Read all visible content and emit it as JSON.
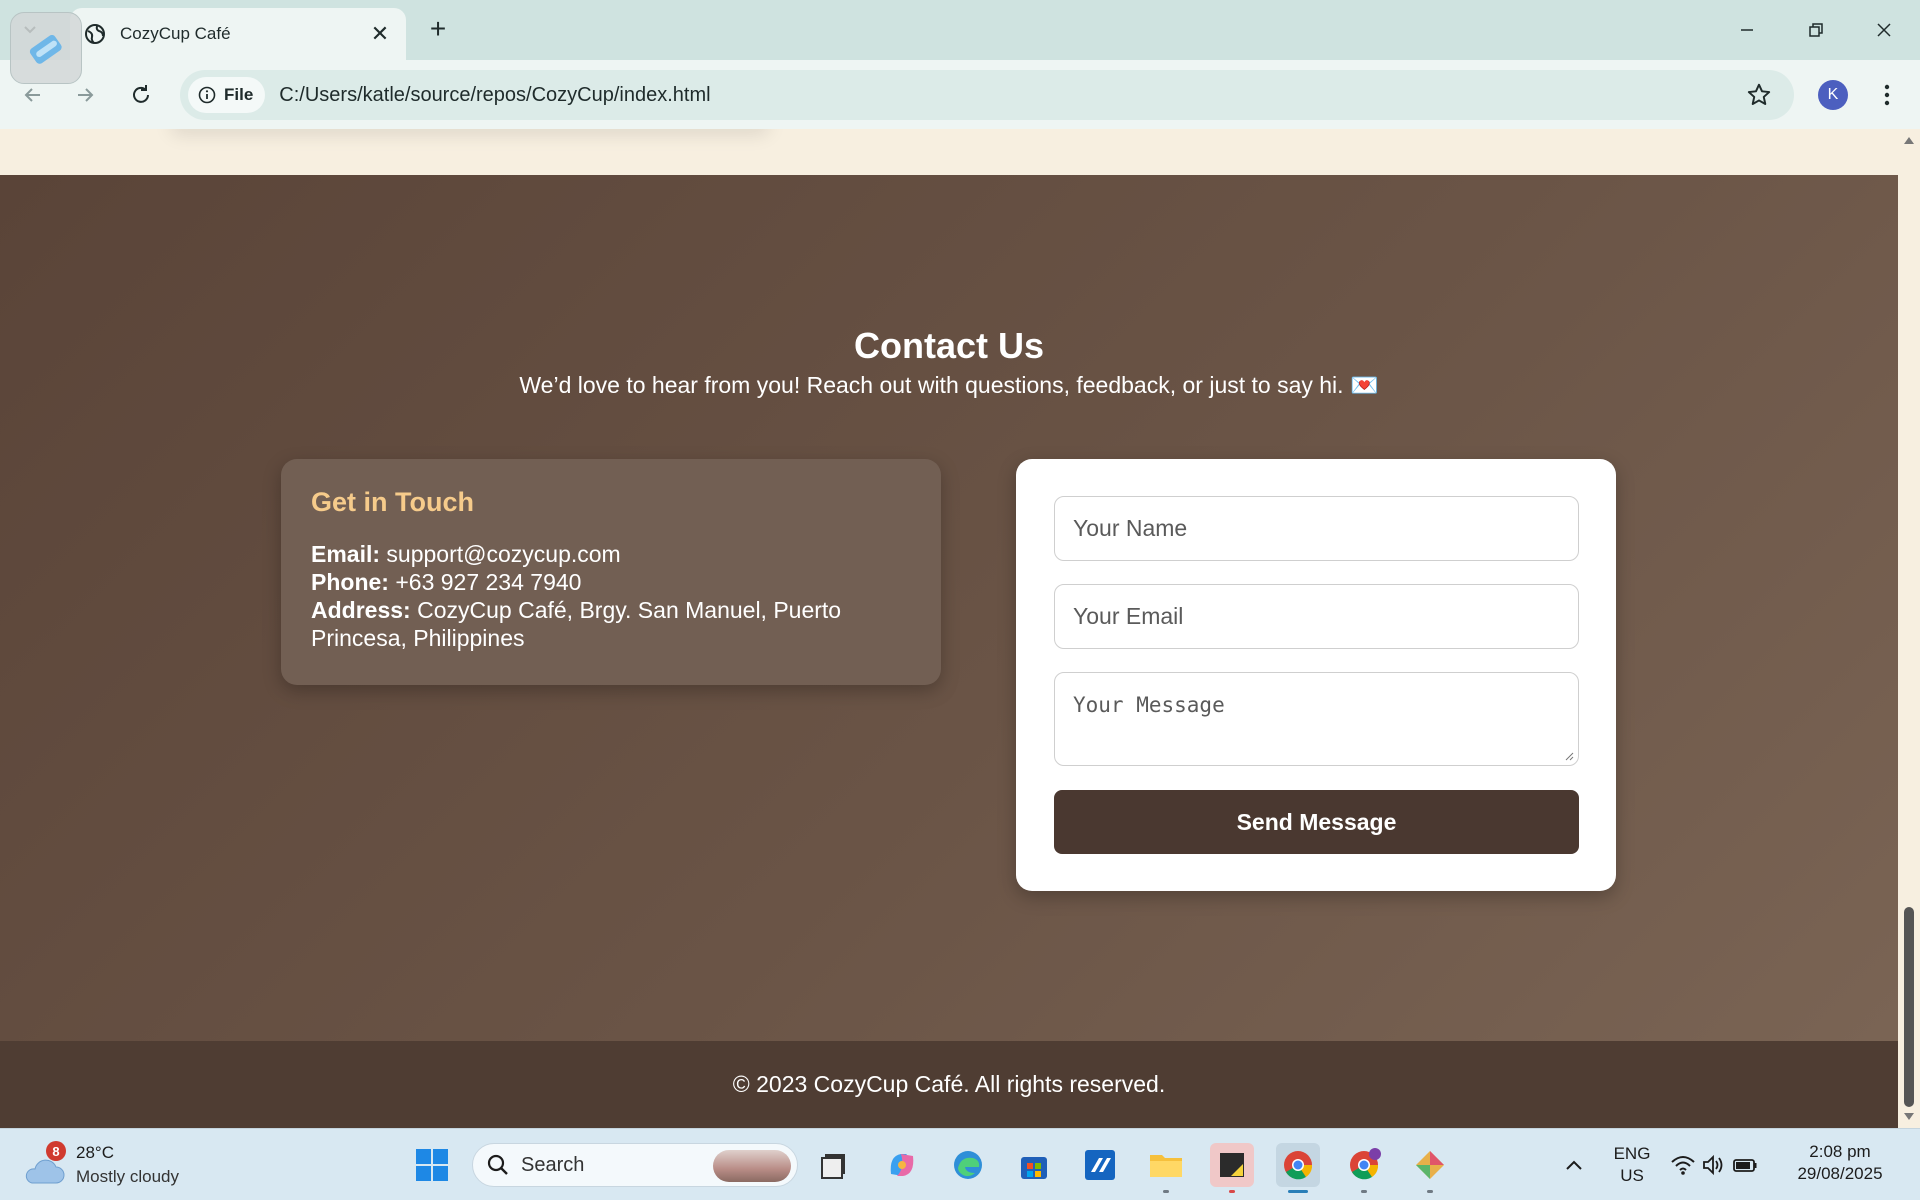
{
  "browser": {
    "tab_title": "CozyCup Café",
    "chip_label": "File",
    "url": "C:/Users/katle/source/repos/CozyCup/index.html",
    "profile_initial": "K"
  },
  "page": {
    "contact": {
      "heading": "Contact Us",
      "subtitle": "We’d love to hear from you! Reach out with questions, feedback, or just to say hi. 💌",
      "info": {
        "heading": "Get in Touch",
        "email_label": "Email:",
        "email_value": "support@cozycup.com",
        "phone_label": "Phone:",
        "phone_value": "+63 927 234 7940",
        "address_label": "Address:",
        "address_value": "CozyCup Café, Brgy. San Manuel, Puerto Princesa, Philippines"
      },
      "form": {
        "name_placeholder": "Your Name",
        "email_placeholder": "Your Email",
        "message_placeholder": "Your Message",
        "submit_label": "Send Message"
      }
    },
    "footer": "© 2023 CozyCup Café. All rights reserved."
  },
  "taskbar": {
    "weather_badge": "8",
    "weather_temp": "28°C",
    "weather_condition": "Mostly cloudy",
    "search_label": "Search",
    "language": "ENG",
    "region": "US",
    "time": "2:08 pm",
    "date": "29/08/2025"
  },
  "colors": {
    "contact_bg": "#5a4438",
    "info_card_bg": "#725f53",
    "accent_heading": "#f6cb8b",
    "button_bg": "#4a3830",
    "footer_bg": "#4f3d33"
  }
}
